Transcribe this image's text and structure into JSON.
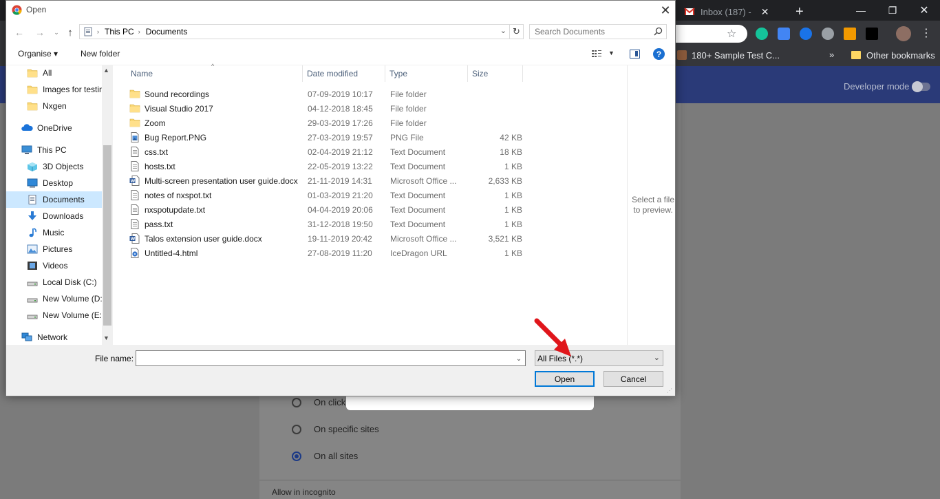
{
  "chrome": {
    "tabs": [
      {
        "label": "Inbox (187) - "
      },
      {
        "label": ""
      }
    ],
    "new_tab": "+",
    "bookmarks": [
      {
        "label": "180+ Sample Test C..."
      },
      {
        "label": "»"
      },
      {
        "label": "Other bookmarks"
      }
    ]
  },
  "page": {
    "developer_mode": "Developer mode",
    "options": [
      {
        "label": "On click",
        "selected": false
      },
      {
        "label": "On specific sites",
        "selected": false
      },
      {
        "label": "On all sites",
        "selected": true
      }
    ],
    "allow_incognito": "Allow in incognito"
  },
  "dialog": {
    "title": "Open",
    "address": {
      "crumbs": [
        "This PC",
        "Documents"
      ]
    },
    "search_placeholder": "Search Documents",
    "toolbar": {
      "organise": "Organise ▾",
      "new_folder": "New folder"
    },
    "nav": [
      {
        "label": "All",
        "icon": "folder-icon",
        "indent": 1
      },
      {
        "label": "Images for testing",
        "icon": "folder-icon",
        "indent": 1
      },
      {
        "label": "Nxgen",
        "icon": "folder-icon",
        "indent": 1
      },
      {
        "label": "OneDrive",
        "icon": "onedrive-icon",
        "indent": 0
      },
      {
        "label": "This PC",
        "icon": "pc-icon",
        "indent": 0
      },
      {
        "label": "3D Objects",
        "icon": "3d-objects-icon",
        "indent": 1
      },
      {
        "label": "Desktop",
        "icon": "desktop-icon",
        "indent": 1
      },
      {
        "label": "Documents",
        "icon": "documents-icon",
        "indent": 1,
        "selected": true
      },
      {
        "label": "Downloads",
        "icon": "downloads-icon",
        "indent": 1
      },
      {
        "label": "Music",
        "icon": "music-icon",
        "indent": 1
      },
      {
        "label": "Pictures",
        "icon": "pictures-icon",
        "indent": 1
      },
      {
        "label": "Videos",
        "icon": "videos-icon",
        "indent": 1
      },
      {
        "label": "Local Disk (C:)",
        "icon": "drive-icon",
        "indent": 1
      },
      {
        "label": "New Volume (D:)",
        "icon": "drive-icon",
        "indent": 1
      },
      {
        "label": "New Volume (E:)",
        "icon": "drive-icon",
        "indent": 1
      },
      {
        "label": "Network",
        "icon": "network-icon",
        "indent": 0
      }
    ],
    "columns": {
      "name": "Name",
      "date": "Date modified",
      "type": "Type",
      "size": "Size"
    },
    "files": [
      {
        "name": "Sound recordings",
        "date": "07-09-2019 10:17",
        "type": "File folder",
        "size": "",
        "icon": "folder-icon"
      },
      {
        "name": "Visual Studio 2017",
        "date": "04-12-2018 18:45",
        "type": "File folder",
        "size": "",
        "icon": "folder-icon"
      },
      {
        "name": "Zoom",
        "date": "29-03-2019 17:26",
        "type": "File folder",
        "size": "",
        "icon": "folder-icon"
      },
      {
        "name": "Bug Report.PNG",
        "date": "27-03-2019 19:57",
        "type": "PNG File",
        "size": "42 KB",
        "icon": "image-file-icon"
      },
      {
        "name": "css.txt",
        "date": "02-04-2019 21:12",
        "type": "Text Document",
        "size": "18 KB",
        "icon": "text-file-icon"
      },
      {
        "name": "hosts.txt",
        "date": "22-05-2019 13:22",
        "type": "Text Document",
        "size": "1 KB",
        "icon": "text-file-icon"
      },
      {
        "name": "Multi-screen presentation user guide.docx",
        "date": "21-11-2019 14:31",
        "type": "Microsoft Office ...",
        "size": "2,633 KB",
        "icon": "word-file-icon"
      },
      {
        "name": "notes of nxspot.txt",
        "date": "01-03-2019 21:20",
        "type": "Text Document",
        "size": "1 KB",
        "icon": "text-file-icon"
      },
      {
        "name": "nxspotupdate.txt",
        "date": "04-04-2019 20:06",
        "type": "Text Document",
        "size": "1 KB",
        "icon": "text-file-icon"
      },
      {
        "name": "pass.txt",
        "date": "31-12-2018 19:50",
        "type": "Text Document",
        "size": "1 KB",
        "icon": "text-file-icon"
      },
      {
        "name": "Talos extension user guide.docx",
        "date": "19-11-2019 20:42",
        "type": "Microsoft Office ...",
        "size": "3,521 KB",
        "icon": "word-file-icon"
      },
      {
        "name": "Untitled-4.html",
        "date": "27-08-2019 11:20",
        "type": "IceDragon URL",
        "size": "1 KB",
        "icon": "html-file-icon"
      }
    ],
    "preview_text": "Select a file to preview.",
    "file_name_label": "File name:",
    "file_name_value": "",
    "filter": "All Files (*.*)",
    "open_label": "Open",
    "cancel_label": "Cancel"
  }
}
